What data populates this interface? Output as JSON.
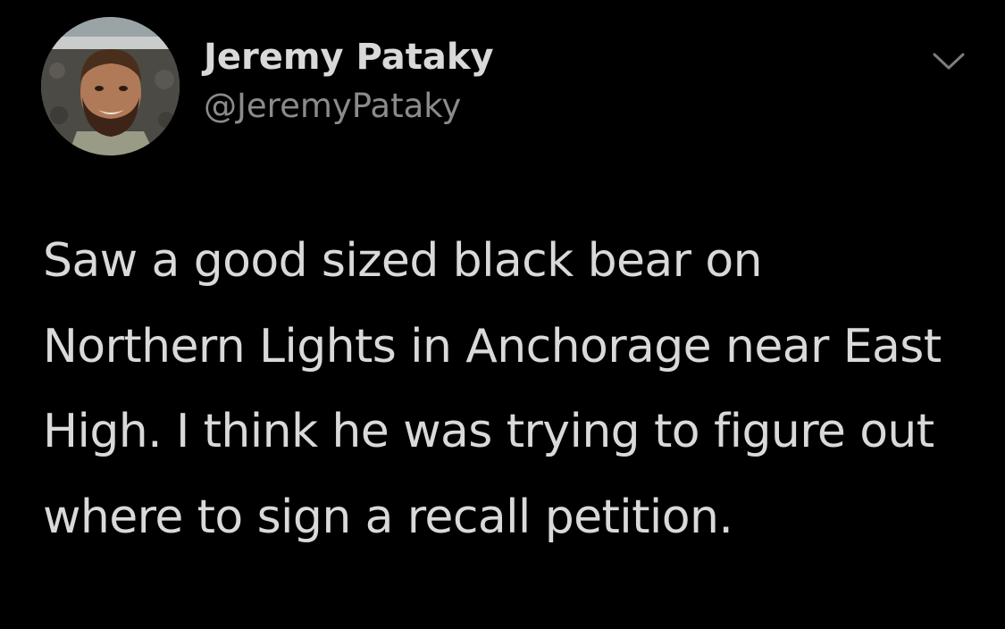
{
  "tweet": {
    "author": {
      "display_name": "Jeremy Pataky",
      "handle": "@JeremyPataky",
      "avatar_icon": "profile-photo-avatar"
    },
    "menu_icon": "chevron-down-icon",
    "text": "Saw a good sized black bear on Northern Lights in Anchorage near East High. I think he was trying to figure out where to sign a recall petition."
  },
  "colors": {
    "background": "#000000",
    "primary_text": "#d9d9d9",
    "secondary_text": "#8b8b8b"
  }
}
